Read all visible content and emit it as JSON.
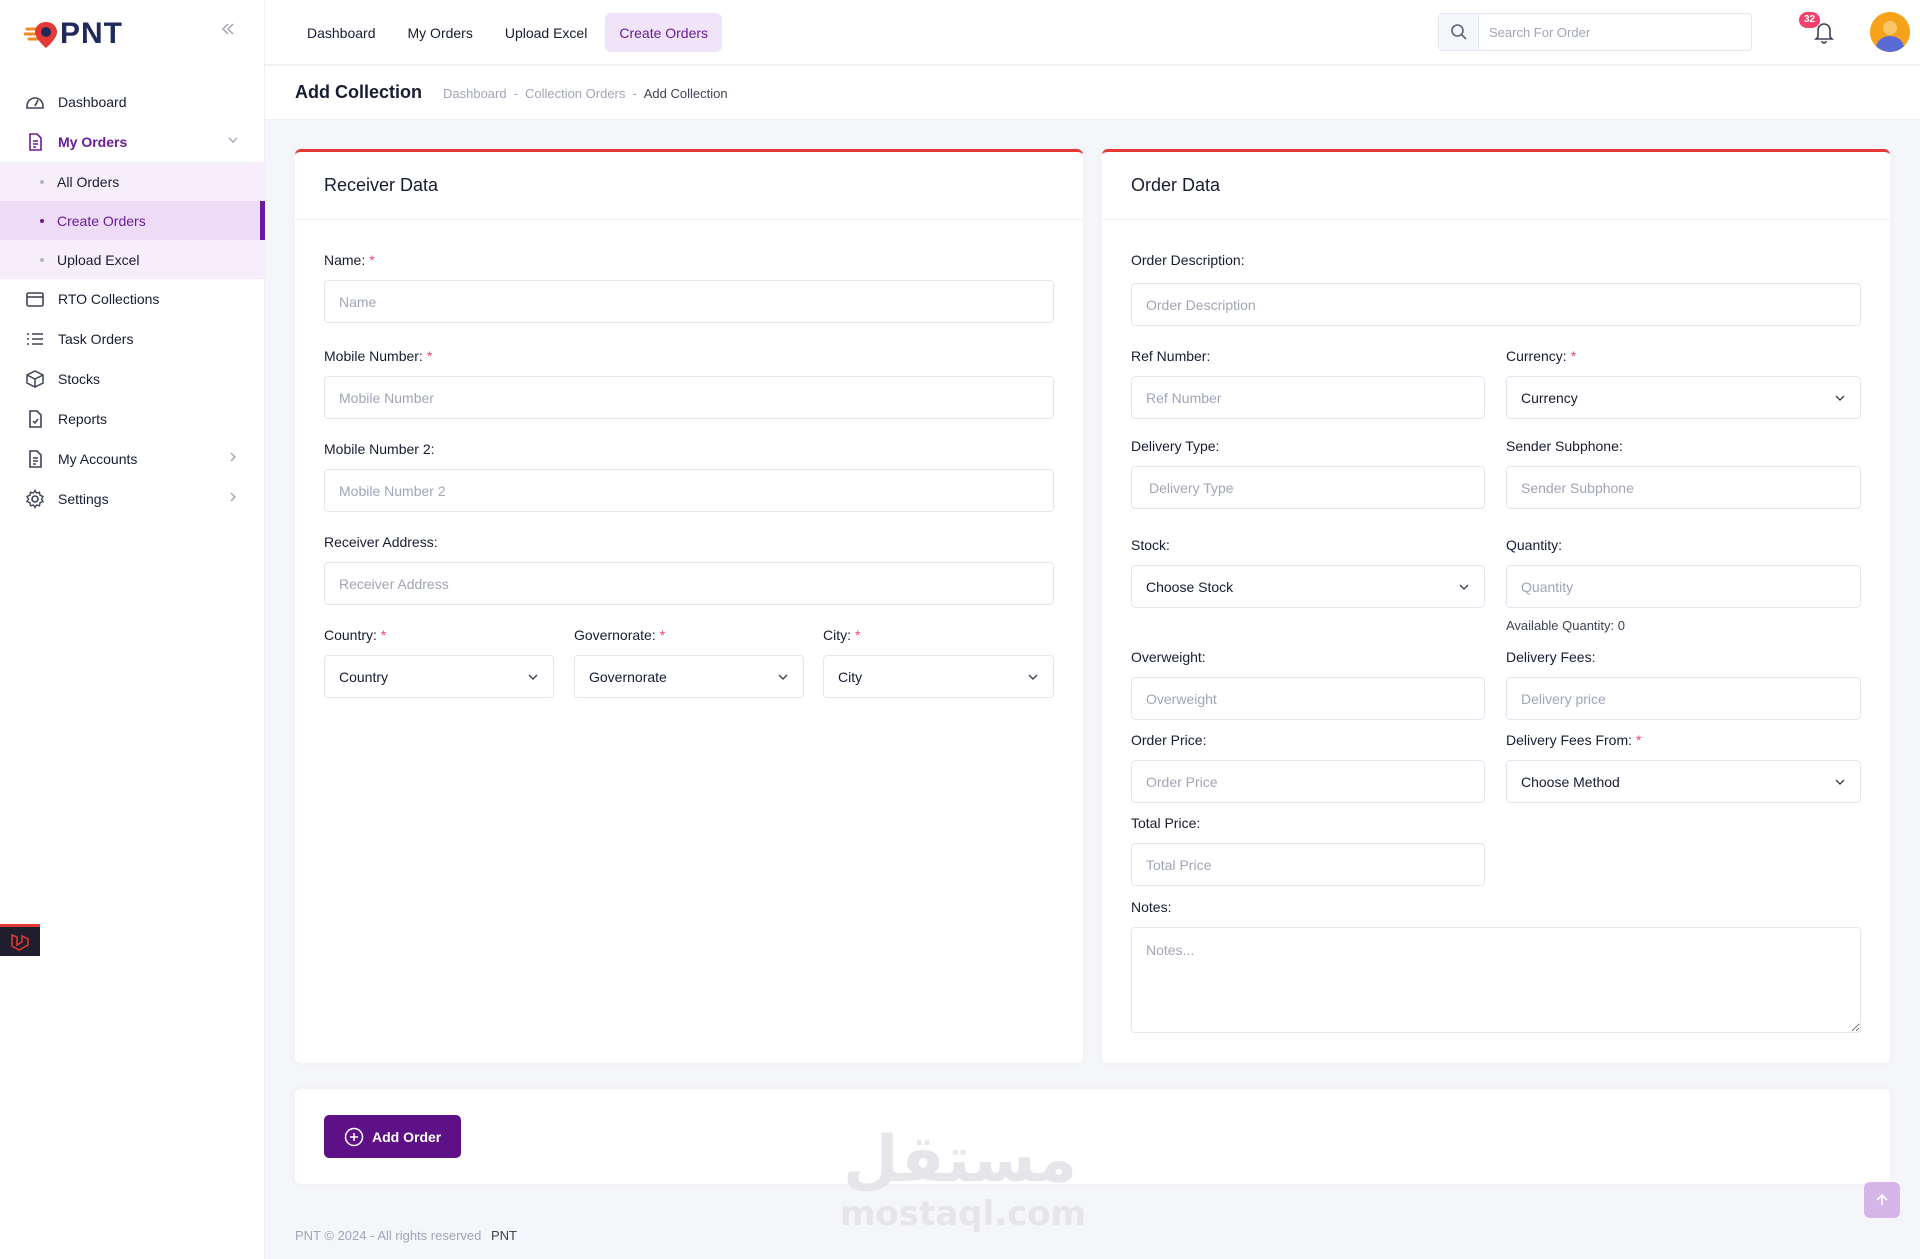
{
  "brand": {
    "logo_text": "PNT"
  },
  "sidebar": {
    "items": [
      {
        "label": "Dashboard",
        "icon": "dashboard-icon"
      },
      {
        "label": "My Orders",
        "icon": "document-icon"
      },
      {
        "label": "RTO Collections",
        "icon": "box-tray-icon"
      },
      {
        "label": "Task Orders",
        "icon": "list-icon"
      },
      {
        "label": "Stocks",
        "icon": "cube-icon"
      },
      {
        "label": "Reports",
        "icon": "report-icon"
      },
      {
        "label": "My Accounts",
        "icon": "document-icon"
      },
      {
        "label": "Settings",
        "icon": "gear-icon"
      }
    ],
    "sub_items": [
      {
        "label": "All Orders"
      },
      {
        "label": "Create Orders"
      },
      {
        "label": "Upload Excel"
      }
    ]
  },
  "topbar": {
    "tabs": [
      {
        "label": "Dashboard"
      },
      {
        "label": "My Orders"
      },
      {
        "label": "Upload Excel"
      },
      {
        "label": "Create Orders"
      }
    ],
    "search_placeholder": "Search For Order",
    "notification_count": "32"
  },
  "page": {
    "title": "Add Collection",
    "breadcrumb": [
      "Dashboard",
      "Collection Orders",
      "Add Collection"
    ],
    "breadcrumb_sep": "-"
  },
  "receiver": {
    "title": "Receiver Data",
    "name": {
      "label": "Name:",
      "placeholder": "Name"
    },
    "mobile": {
      "label": "Mobile Number:",
      "placeholder": "Mobile Number"
    },
    "mobile2": {
      "label": "Mobile Number 2:",
      "placeholder": "Mobile Number 2"
    },
    "address": {
      "label": "Receiver Address:",
      "placeholder": "Receiver Address"
    },
    "country": {
      "label": "Country:",
      "value": "Country"
    },
    "governorate": {
      "label": "Governorate:",
      "value": "Governorate"
    },
    "city": {
      "label": "City:",
      "value": "City"
    }
  },
  "order": {
    "title": "Order Data",
    "description": {
      "label": "Order Description:",
      "placeholder": "Order Description"
    },
    "ref": {
      "label": "Ref Number:",
      "placeholder": "Ref Number"
    },
    "currency": {
      "label": "Currency:",
      "value": "Currency"
    },
    "delivery_type": {
      "label": "Delivery Type:",
      "placeholder": "Delivery Type"
    },
    "sender_subphone": {
      "label": "Sender Subphone:",
      "placeholder": "Sender Subphone"
    },
    "stock": {
      "label": "Stock:",
      "value": "Choose Stock"
    },
    "quantity": {
      "label": "Quantity:",
      "placeholder": "Quantity",
      "hint": "Available Quantity: 0"
    },
    "overweight": {
      "label": "Overweight:",
      "placeholder": "Overweight"
    },
    "delivery_fees": {
      "label": "Delivery Fees:",
      "placeholder": "Delivery price"
    },
    "order_price": {
      "label": "Order Price:",
      "placeholder": "Order Price"
    },
    "delivery_fees_from": {
      "label": "Delivery Fees From:",
      "value": "Choose Method"
    },
    "total_price": {
      "label": "Total Price:",
      "placeholder": "Total Price"
    },
    "notes": {
      "label": "Notes:",
      "placeholder": "Notes..."
    }
  },
  "actions": {
    "add_order": "Add Order"
  },
  "footer": {
    "copyright": "PNT © 2024 - All rights reserved",
    "brand": "PNT"
  },
  "watermark": {
    "arabic": "مستقل",
    "latin": "mostaql.com"
  },
  "colors": {
    "accent": "#6a1b9a",
    "button": "#5e1186",
    "card_top_border": "#e53935",
    "required": "#f1416c"
  }
}
